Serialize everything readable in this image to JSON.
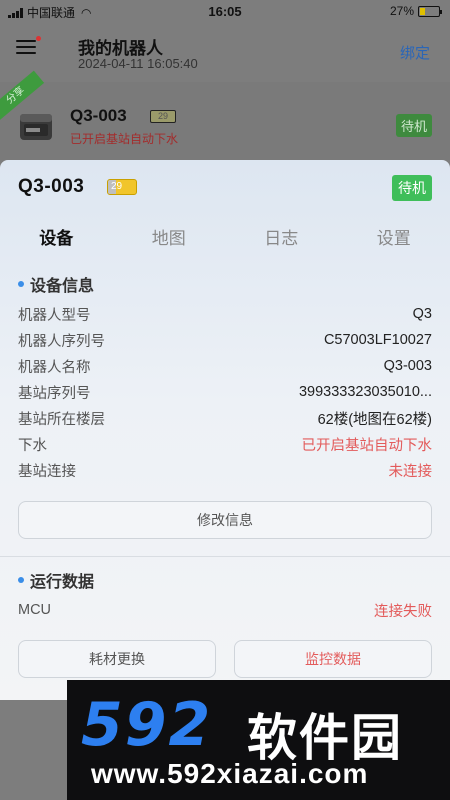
{
  "status_bar": {
    "carrier": "中国联通",
    "time": "16:05",
    "battery": "27%",
    "battery_level": 0.27
  },
  "header": {
    "title": "我的机器人",
    "datetime": "2024-04-11 16:05:40",
    "bind_label": "绑定"
  },
  "robot_item": {
    "ribbon": "分享",
    "name": "Q3-003",
    "battery": "29",
    "status": "已开启基站自动下水",
    "badge": "待机"
  },
  "sheet": {
    "name": "Q3-003",
    "battery": "29",
    "battery_level": 0.29,
    "badge": "待机",
    "tabs": [
      "设备",
      "地图",
      "日志",
      "设置"
    ],
    "device_info": {
      "title": "设备信息",
      "rows": [
        {
          "label": "机器人型号",
          "value": "Q3"
        },
        {
          "label": "机器人序列号",
          "value": "C57003LF10027"
        },
        {
          "label": "机器人名称",
          "value": "Q3-003"
        },
        {
          "label": "基站序列号",
          "value": "399333323035010..."
        },
        {
          "label": "基站所在楼层",
          "value": "62楼(地图在62楼)"
        },
        {
          "label": "下水",
          "value": "已开启基站自动下水"
        },
        {
          "label": "基站连接",
          "value": "未连接"
        }
      ],
      "edit_button": "修改信息"
    },
    "runtime": {
      "title": "运行数据",
      "mcu_label": "MCU",
      "mcu_value": "连接失败",
      "consumables_button": "耗材更换",
      "monitor_button": "监控数据"
    }
  },
  "watermark": {
    "logo": "592",
    "name": "软件园",
    "url": "www.592xiazai.com"
  },
  "colors": {
    "accent": "#2a66b8",
    "status_green": "#3fbe5a",
    "error_red": "#e35b5b",
    "section_dot": "#3a8ee8"
  }
}
